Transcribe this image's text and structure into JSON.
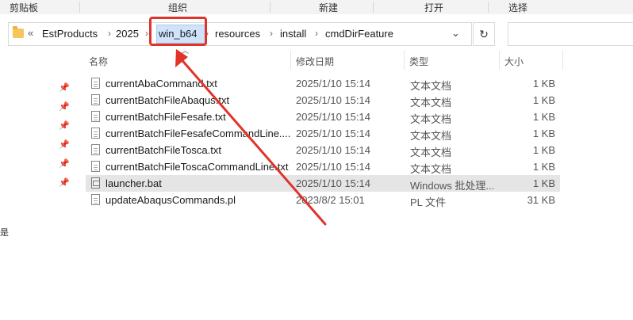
{
  "ribbon": {
    "groups": [
      "剪贴板",
      "组织",
      "新建",
      "打开",
      "选择"
    ]
  },
  "address_bar": {
    "chevron": "«",
    "crumbs": [
      "EstProducts",
      "2025",
      "win_b64",
      "resources",
      "install",
      "cmdDirFeature"
    ],
    "separator": "›",
    "dropdown": "⌄",
    "refresh": "↻"
  },
  "columns": {
    "name": "名称",
    "modified": "修改日期",
    "type": "类型",
    "size": "大小"
  },
  "files": [
    {
      "name": "currentAbaCommand.txt",
      "modified": "2025/1/10 15:14",
      "type": "文本文档",
      "size": "1 KB",
      "icon": "text-file-icon"
    },
    {
      "name": "currentBatchFileAbaqus.txt",
      "modified": "2025/1/10 15:14",
      "type": "文本文档",
      "size": "1 KB",
      "icon": "text-file-icon"
    },
    {
      "name": "currentBatchFileFesafe.txt",
      "modified": "2025/1/10 15:14",
      "type": "文本文档",
      "size": "1 KB",
      "icon": "text-file-icon"
    },
    {
      "name": "currentBatchFileFesafeCommandLine....",
      "modified": "2025/1/10 15:14",
      "type": "文本文档",
      "size": "1 KB",
      "icon": "text-file-icon"
    },
    {
      "name": "currentBatchFileTosca.txt",
      "modified": "2025/1/10 15:14",
      "type": "文本文档",
      "size": "1 KB",
      "icon": "text-file-icon"
    },
    {
      "name": "currentBatchFileToscaCommandLine.txt",
      "modified": "2025/1/10 15:14",
      "type": "文本文档",
      "size": "1 KB",
      "icon": "text-file-icon"
    },
    {
      "name": "launcher.bat",
      "modified": "2025/1/10 15:14",
      "type": "Windows 批处理...",
      "size": "1 KB",
      "icon": "batch-file-icon",
      "selected": true
    },
    {
      "name": "updateAbaqusCommands.pl",
      "modified": "2023/8/2 15:01",
      "type": "PL 文件",
      "size": "31 KB",
      "icon": "text-file-icon"
    }
  ],
  "pins": [
    "pin-icon",
    "pin-icon",
    "pin-icon",
    "pin-icon",
    "pin-icon",
    "pin-icon"
  ],
  "left_mark": "是",
  "colors": {
    "highlight_box": "#e0332a",
    "selected_row": "#e5e5e5",
    "crumb_highlight": "#cfe3fb"
  }
}
